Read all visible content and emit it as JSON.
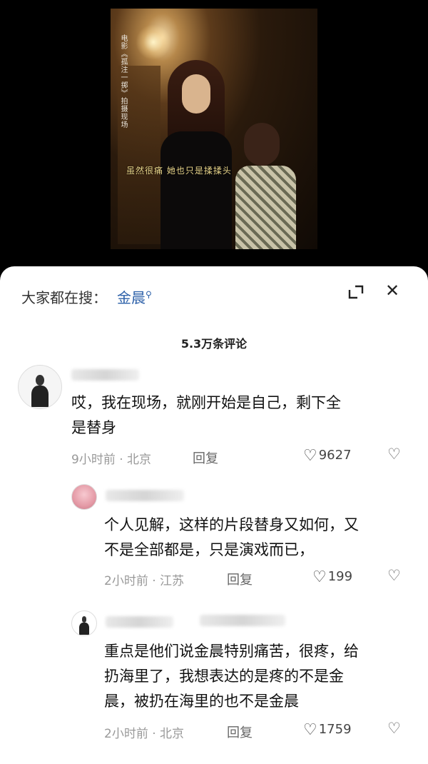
{
  "video": {
    "vertical_caption": "电影《孤注一掷》拍摄现场",
    "subtitle": "虽然很痛 她也只是揉揉头"
  },
  "search": {
    "prefix": "大家都在搜：",
    "term": "金晨"
  },
  "comments_count": "5.3万条评论",
  "comments": [
    {
      "text_line1": "哎，我在现场，就刚开始是自己，剩下全",
      "text_line2": "是替身",
      "time": "9小时前 · 北京",
      "reply": "回复",
      "likes": "9627"
    },
    {
      "text_line1": "个人见解，这样的片段替身又如何，又",
      "text_line2": "不是全部都是，只是演戏而已，",
      "time": "2小时前 · 江苏",
      "reply": "回复",
      "likes": "199"
    },
    {
      "text_line1": "重点是他们说金晨特别痛苦，很疼，给",
      "text_line2": "扔海里了，我想表达的是疼的不是金",
      "text_line3": "晨，被扔在海里的也不是金晨",
      "time": "2小时前 · 北京",
      "reply": "回复",
      "likes": "1759"
    }
  ]
}
